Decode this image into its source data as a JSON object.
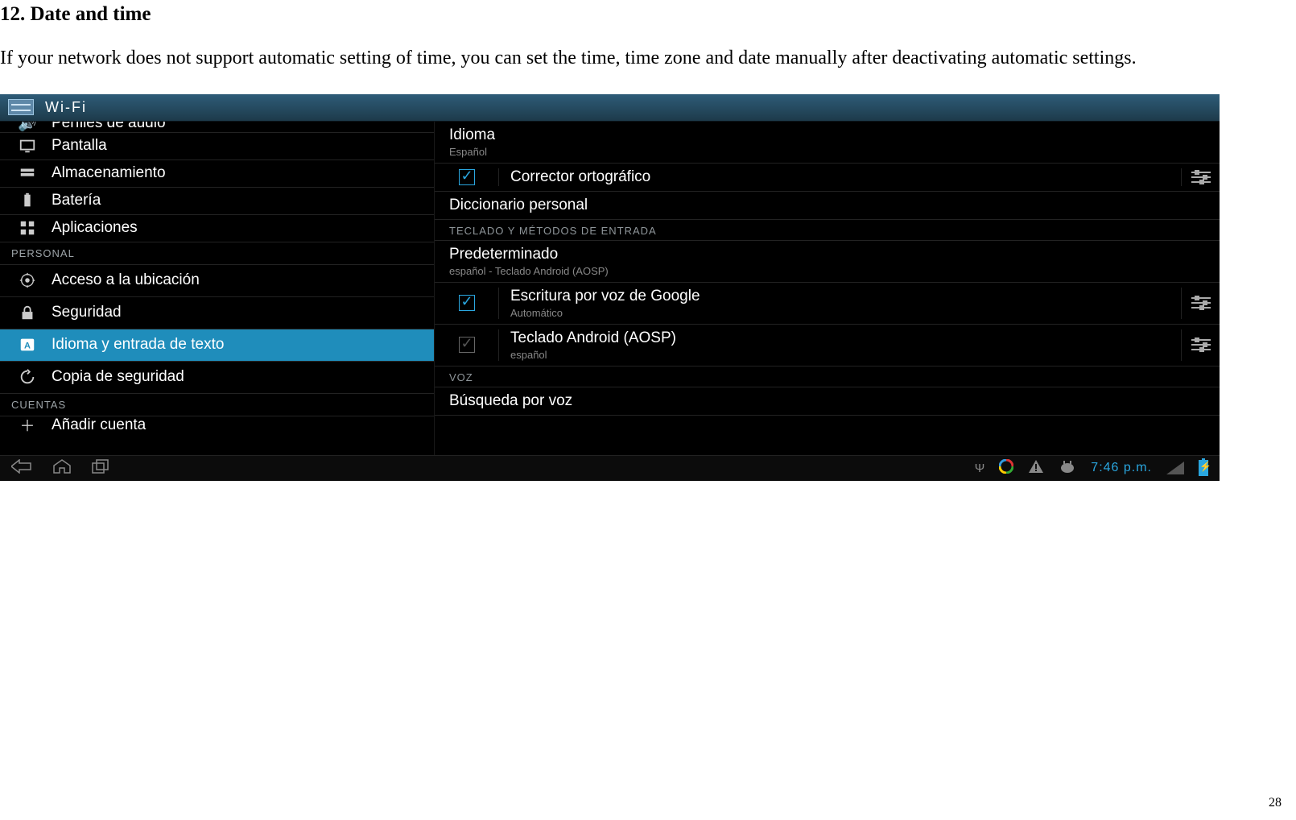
{
  "doc": {
    "heading": "12. Date and time",
    "paragraph": "If your network does not support automatic setting of time, you can set the time, time zone and date manually after deactivating automatic settings.",
    "page_number": "28"
  },
  "titlebar": {
    "label": "Wi-Fi"
  },
  "left": {
    "cutoff_top": "Perfiles de audio",
    "items": [
      {
        "label": "Pantalla"
      },
      {
        "label": "Almacenamiento"
      },
      {
        "label": "Batería"
      },
      {
        "label": "Aplicaciones"
      }
    ],
    "section_personal": "PERSONAL",
    "personal_items": [
      {
        "label": "Acceso a la ubicación"
      },
      {
        "label": "Seguridad"
      },
      {
        "label": "Idioma y entrada de texto",
        "selected": true
      },
      {
        "label": "Copia de seguridad"
      }
    ],
    "section_accounts": "CUENTAS",
    "cutoff_bot": "Añadir cuenta"
  },
  "right": {
    "idioma": {
      "title": "Idioma",
      "sub": "Español"
    },
    "corrector": {
      "label": "Corrector ortográfico"
    },
    "diccionario": {
      "title": "Diccionario personal"
    },
    "section_keyboard": "TECLADO Y MÉTODOS DE ENTRADA",
    "predeterminado": {
      "title": "Predeterminado",
      "sub": "español - Teclado Android (AOSP)"
    },
    "voice_typing": {
      "title": "Escritura por voz de Google",
      "sub": "Automático"
    },
    "aosp_keyboard": {
      "title": "Teclado Android (AOSP)",
      "sub": "español"
    },
    "section_voice": "VOZ",
    "voice_search": {
      "title": "Búsqueda por voz"
    }
  },
  "statusbar": {
    "clock": "7:46 p.m."
  }
}
